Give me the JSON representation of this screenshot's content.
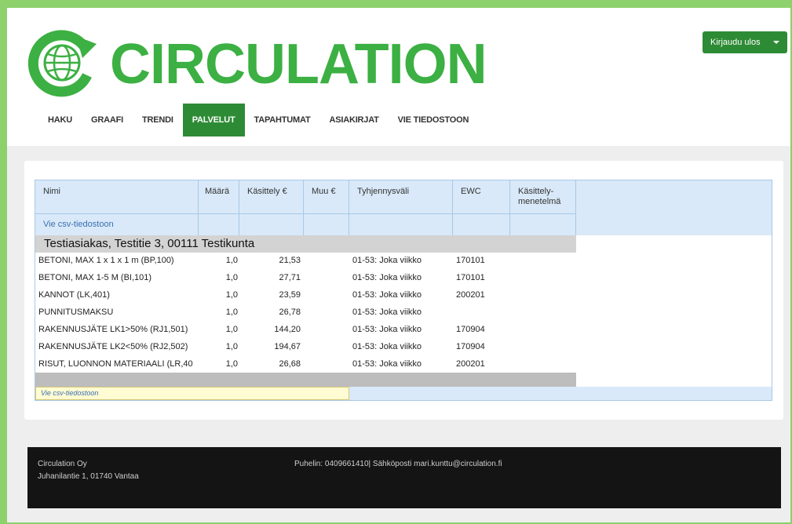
{
  "app": {
    "brand_name": "CIRCULATION",
    "brand_color": "#3cb043",
    "accent_color": "#2e8b35"
  },
  "header": {
    "logout_label": "Kirjaudu ulos"
  },
  "nav": {
    "items": [
      {
        "label": "HAKU",
        "active": false
      },
      {
        "label": "GRAAFI",
        "active": false
      },
      {
        "label": "TRENDI",
        "active": false
      },
      {
        "label": "PALVELUT",
        "active": true
      },
      {
        "label": "TAPAHTUMAT",
        "active": false
      },
      {
        "label": "ASIAKIRJAT",
        "active": false
      },
      {
        "label": "VIE TIEDOSTOON",
        "active": false
      }
    ]
  },
  "table": {
    "columns": [
      {
        "label": "Nimi"
      },
      {
        "label": "Määrä"
      },
      {
        "label": "Käsittely €"
      },
      {
        "label": "Muu €"
      },
      {
        "label": "Tyhjennysväli"
      },
      {
        "label": "EWC"
      },
      {
        "label": "Käsittely-menetelmä"
      }
    ],
    "csv_link": "Vie csv-tiedostoon",
    "group_title": "Testiasiakas, Testitie 3, 00111 Testikunta",
    "rows": [
      {
        "name": "BETONI, MAX 1 x 1 x 1 m (BP,100)",
        "qty": "1,0",
        "cost": "21,53",
        "interval": "01-53: Joka viikko",
        "ewc": "170101"
      },
      {
        "name": "BETONI, MAX 1-5 M (BI,101)",
        "qty": "1,0",
        "cost": "27,71",
        "interval": "01-53: Joka viikko",
        "ewc": "170101"
      },
      {
        "name": "KANNOT (LK,401)",
        "qty": "1,0",
        "cost": "23,59",
        "interval": "01-53: Joka viikko",
        "ewc": "200201"
      },
      {
        "name": "PUNNITUSMAKSU",
        "qty": "1,0",
        "cost": "26,78",
        "interval": "01-53: Joka viikko",
        "ewc": ""
      },
      {
        "name": "RAKENNUSJÄTE LK1>50% (RJ1,501)",
        "qty": "1,0",
        "cost": "144,20",
        "interval": "01-53: Joka viikko",
        "ewc": "170904"
      },
      {
        "name": "RAKENNUSJÄTE LK2<50% (RJ2,502)",
        "qty": "1,0",
        "cost": "194,67",
        "interval": "01-53: Joka viikko",
        "ewc": "170904"
      },
      {
        "name": "RISUT, LUONNON MATERIAALI (LR,40",
        "qty": "1,0",
        "cost": "26,68",
        "interval": "01-53: Joka viikko",
        "ewc": "200201"
      }
    ],
    "csv_link_footer": "Vie csv-tiedostoon"
  },
  "footer": {
    "company": "Circulation Oy",
    "address": "Juhanilantie 1, 01740 Vantaa",
    "contact": "Puhelin: 0409661410| Sähköposti mari.kunttu@circulation.fi"
  }
}
